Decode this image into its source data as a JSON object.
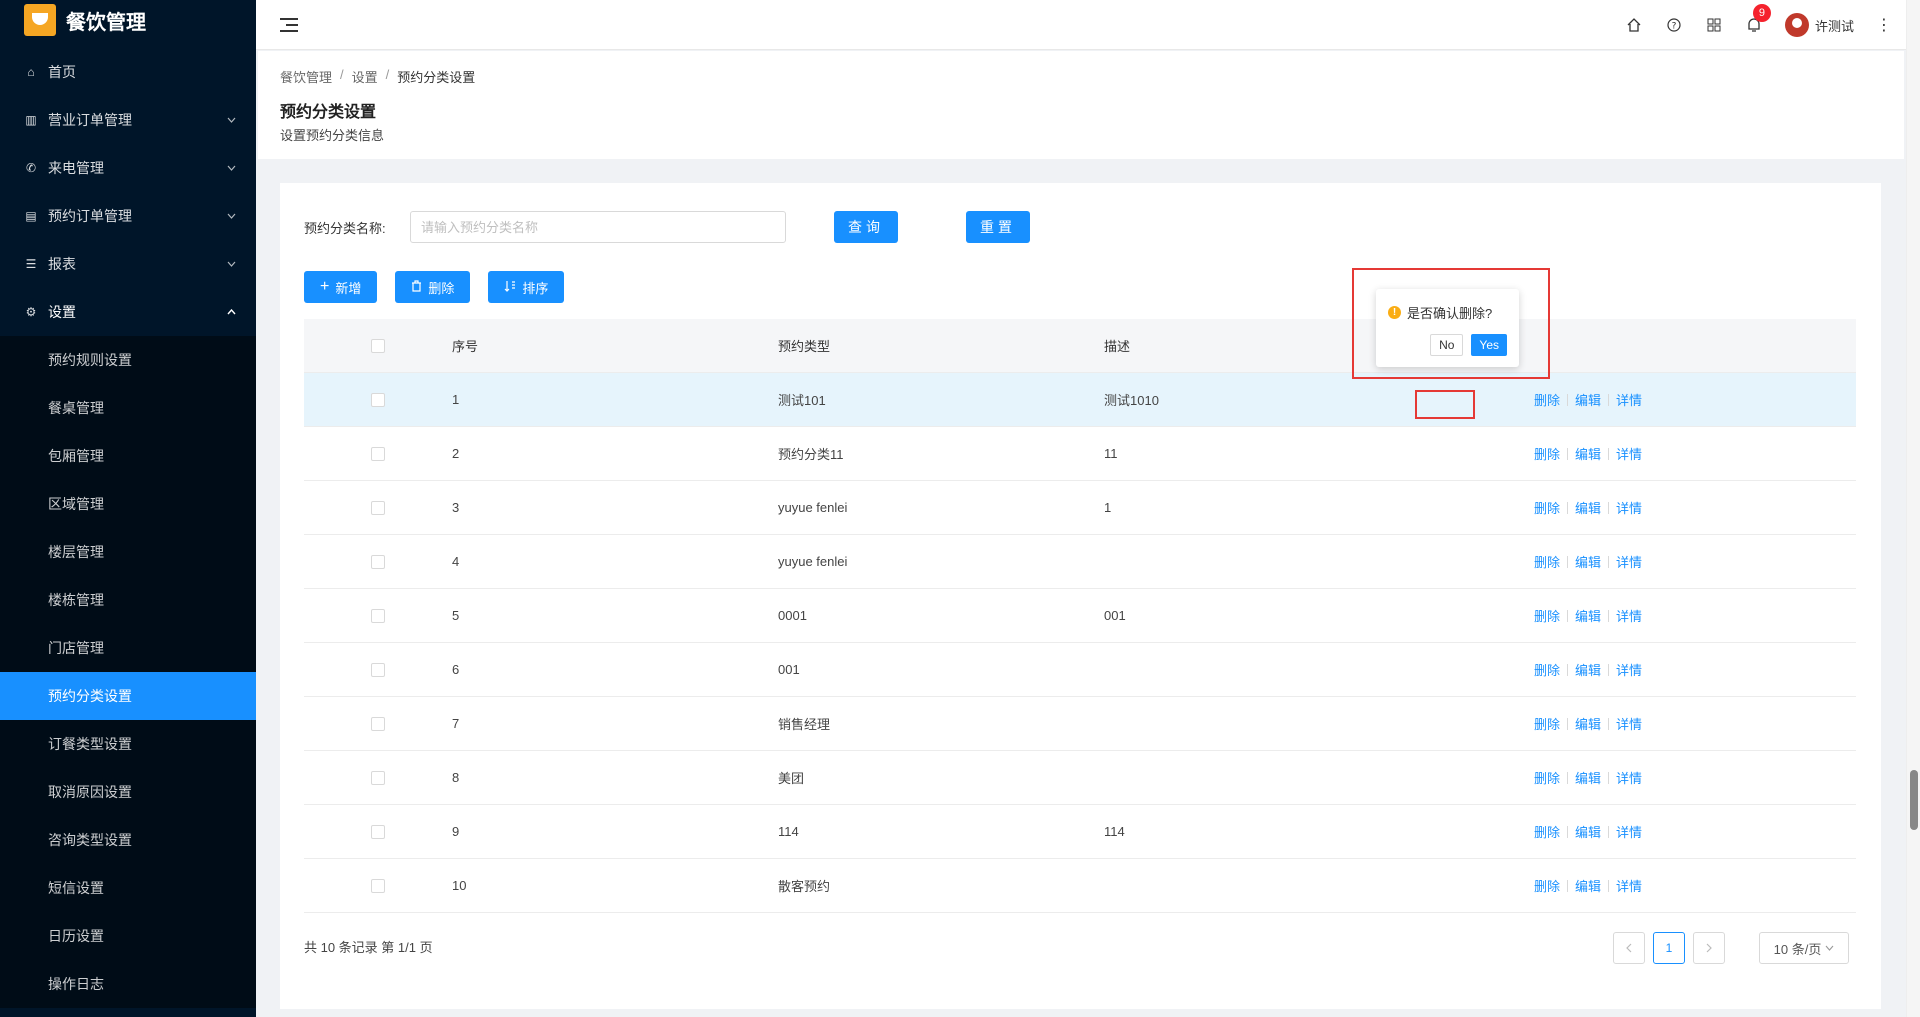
{
  "app": {
    "title": "餐饮管理"
  },
  "sidebar": {
    "items": [
      {
        "label": "首页",
        "icon": "home-icon",
        "has_arrow": false
      },
      {
        "label": "营业订单管理",
        "icon": "chart-icon",
        "has_arrow": true
      },
      {
        "label": "来电管理",
        "icon": "phone-icon",
        "has_arrow": true
      },
      {
        "label": "预约订单管理",
        "icon": "list-icon",
        "has_arrow": true
      },
      {
        "label": "报表",
        "icon": "menu-lines-icon",
        "has_arrow": true
      },
      {
        "label": "设置",
        "icon": "gear-icon",
        "has_arrow": true,
        "open": true
      }
    ],
    "sub_items": [
      {
        "label": "预约规则设置",
        "active": false
      },
      {
        "label": "餐桌管理",
        "active": false
      },
      {
        "label": "包厢管理",
        "active": false
      },
      {
        "label": "区域管理",
        "active": false
      },
      {
        "label": "楼层管理",
        "active": false
      },
      {
        "label": "楼栋管理",
        "active": false
      },
      {
        "label": "门店管理",
        "active": false
      },
      {
        "label": "预约分类设置",
        "active": true
      },
      {
        "label": "订餐类型设置",
        "active": false
      },
      {
        "label": "取消原因设置",
        "active": false
      },
      {
        "label": "咨询类型设置",
        "active": false
      },
      {
        "label": "短信设置",
        "active": false
      },
      {
        "label": "日历设置",
        "active": false
      },
      {
        "label": "操作日志",
        "active": false
      }
    ]
  },
  "header": {
    "notification_count": "9",
    "user_name": "许测试"
  },
  "breadcrumb": [
    "餐饮管理",
    "设置",
    "预约分类设置"
  ],
  "page": {
    "title": "预约分类设置",
    "description": "设置预约分类信息"
  },
  "search": {
    "label": "预约分类名称:",
    "placeholder": "请输入预约分类名称",
    "value": "",
    "query_label": "查询",
    "reset_label": "重置"
  },
  "toolbar": {
    "add_label": "新增",
    "delete_label": "删除",
    "sort_label": "排序"
  },
  "table": {
    "columns": [
      "序号",
      "预约类型",
      "描述",
      ""
    ],
    "rows": [
      {
        "idx": "1",
        "type": "测试101",
        "desc": "测试1010"
      },
      {
        "idx": "2",
        "type": "预约分类11",
        "desc": "11"
      },
      {
        "idx": "3",
        "type": "yuyue fenlei",
        "desc": "1"
      },
      {
        "idx": "4",
        "type": "yuyue fenlei",
        "desc": ""
      },
      {
        "idx": "5",
        "type": "0001",
        "desc": "001"
      },
      {
        "idx": "6",
        "type": "001",
        "desc": ""
      },
      {
        "idx": "7",
        "type": "销售经理",
        "desc": ""
      },
      {
        "idx": "8",
        "type": "美团",
        "desc": ""
      },
      {
        "idx": "9",
        "type": "114",
        "desc": "114"
      },
      {
        "idx": "10",
        "type": "散客预约",
        "desc": ""
      }
    ],
    "actions": {
      "delete": "删除",
      "edit": "编辑",
      "detail": "详情"
    }
  },
  "pagination": {
    "total_text": "共 10 条记录 第 1/1 页",
    "current_page": "1",
    "page_size": "10 条/页"
  },
  "popconfirm": {
    "message": "是否确认删除?",
    "no_label": "No",
    "yes_label": "Yes"
  },
  "colors": {
    "primary": "#1890ff",
    "sidebar_bg": "#001529",
    "highlight": "#e53935"
  }
}
